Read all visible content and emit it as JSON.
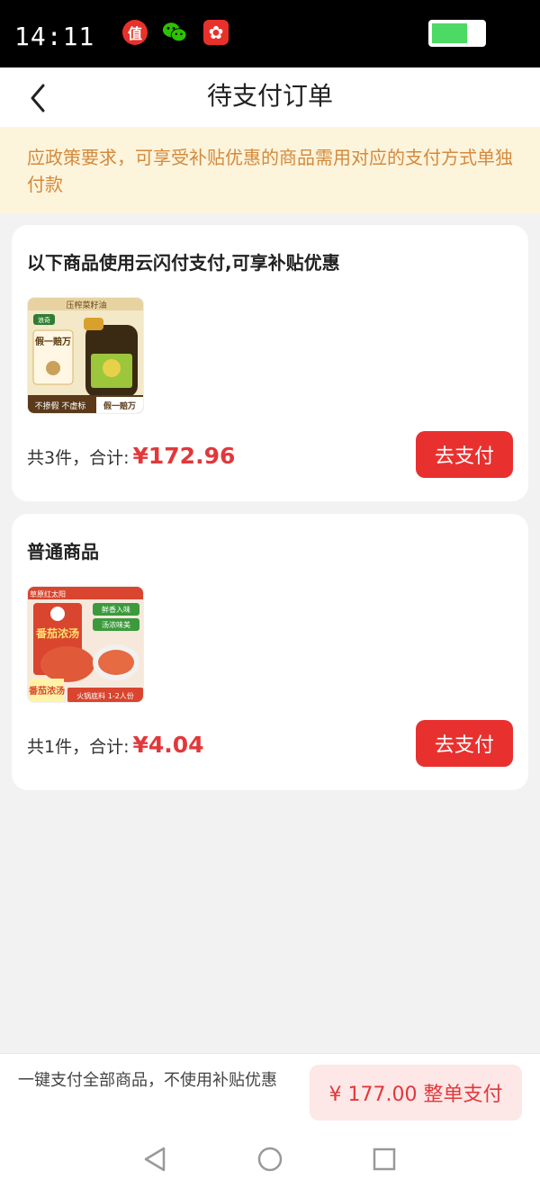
{
  "status_bar": {
    "time": "14:11",
    "icons": [
      "zhi-app-icon",
      "wechat-icon",
      "shop-app-icon"
    ],
    "zhi_glyph": "值",
    "wechat_glyph": "●",
    "shop_glyph": "✿",
    "battery_level": 0.7
  },
  "nav": {
    "title": "待支付订单",
    "back_icon": "chevron-left-icon"
  },
  "notice": {
    "text": "应政策要求，可享受补贴优惠的商品需用对应的支付方式单独付款"
  },
  "orders": [
    {
      "title": "以下商品使用云闪付支付,可享补贴优惠",
      "product": {
        "brand_badge": "浪奇",
        "tagline": "压榨菜籽油",
        "promo": "假一赔万",
        "bottom_tags": "不掺假 不虚标",
        "bottom_promo": "假一赔万"
      },
      "summary_label": "共3件，合计:",
      "price": "¥172.96",
      "pay_label": "去支付"
    },
    {
      "title": "普通商品",
      "product": {
        "brand": "草原红太阳",
        "name": "番茄浓汤",
        "badge_1": "鲜香入味",
        "badge_2": "汤浓味美",
        "caption": "番茄浓汤",
        "tag": "火锅底料 1-2人份"
      },
      "summary_label": "共1件，合计:",
      "price": "¥4.04",
      "pay_label": "去支付"
    }
  ],
  "bottom": {
    "note": "一键支付全部商品，不使用补贴优惠",
    "whole_pay": "¥ 177.00 整单支付"
  },
  "colors": {
    "accent": "#e8312f",
    "notice_bg": "#fdf4dc",
    "notice_text": "#d48a3c"
  }
}
